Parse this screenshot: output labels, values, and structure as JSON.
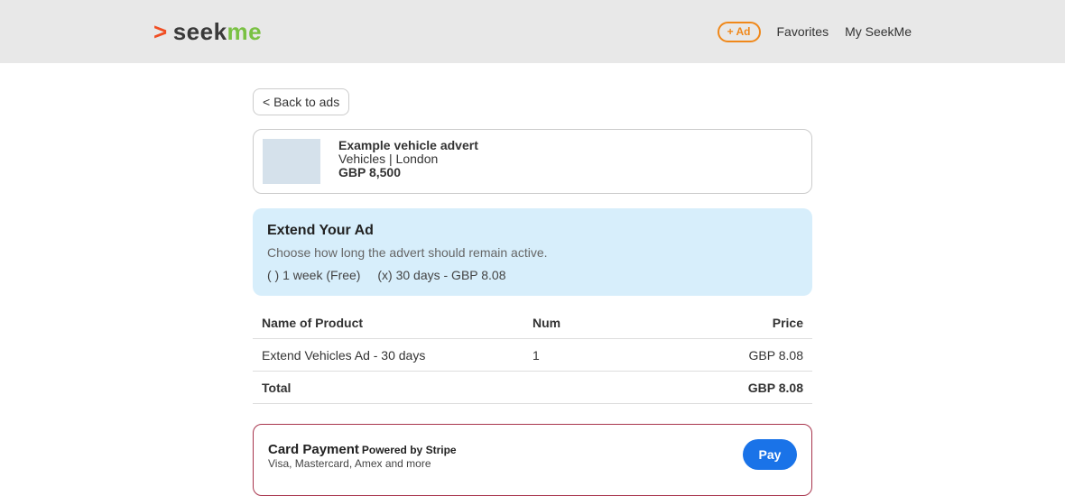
{
  "header": {
    "logo": {
      "arrow": ">",
      "seek": "seek",
      "me": "me"
    },
    "nav": {
      "ad_button": "+ Ad",
      "favorites": "Favorites",
      "my_seekme": "My SeekMe"
    }
  },
  "main": {
    "back_button": "< Back to ads",
    "advert": {
      "title": "Example vehicle advert",
      "category_location": "Vehicles | London",
      "price": "GBP 8,500"
    },
    "extend": {
      "title": "Extend Your Ad",
      "description": "Choose how long the advert should remain active.",
      "options": [
        {
          "label": "( ) 1 week (Free)",
          "selected": false
        },
        {
          "label": "(x) 30 days - GBP 8.08",
          "selected": true
        }
      ]
    },
    "order_table": {
      "headers": {
        "name": "Name of Product",
        "num": "Num",
        "price": "Price"
      },
      "rows": [
        {
          "name": "Extend Vehicles Ad - 30 days",
          "num": "1",
          "price": "GBP 8.08"
        }
      ],
      "total": {
        "label": "Total",
        "price": "GBP 8.08"
      }
    },
    "payment": {
      "title": "Card Payment",
      "powered_by": "Powered by Stripe",
      "subtitle": "Visa, Mastercard, Amex and more",
      "pay_button": "Pay"
    }
  },
  "colors": {
    "header_bg": "#e8e8e8",
    "logo_arrow": "#f04e23",
    "logo_me": "#7ac143",
    "ad_button": "#f0881a",
    "extend_bg": "#d7eefb",
    "payment_border": "#a8354d",
    "pay_button": "#1a73e8"
  }
}
